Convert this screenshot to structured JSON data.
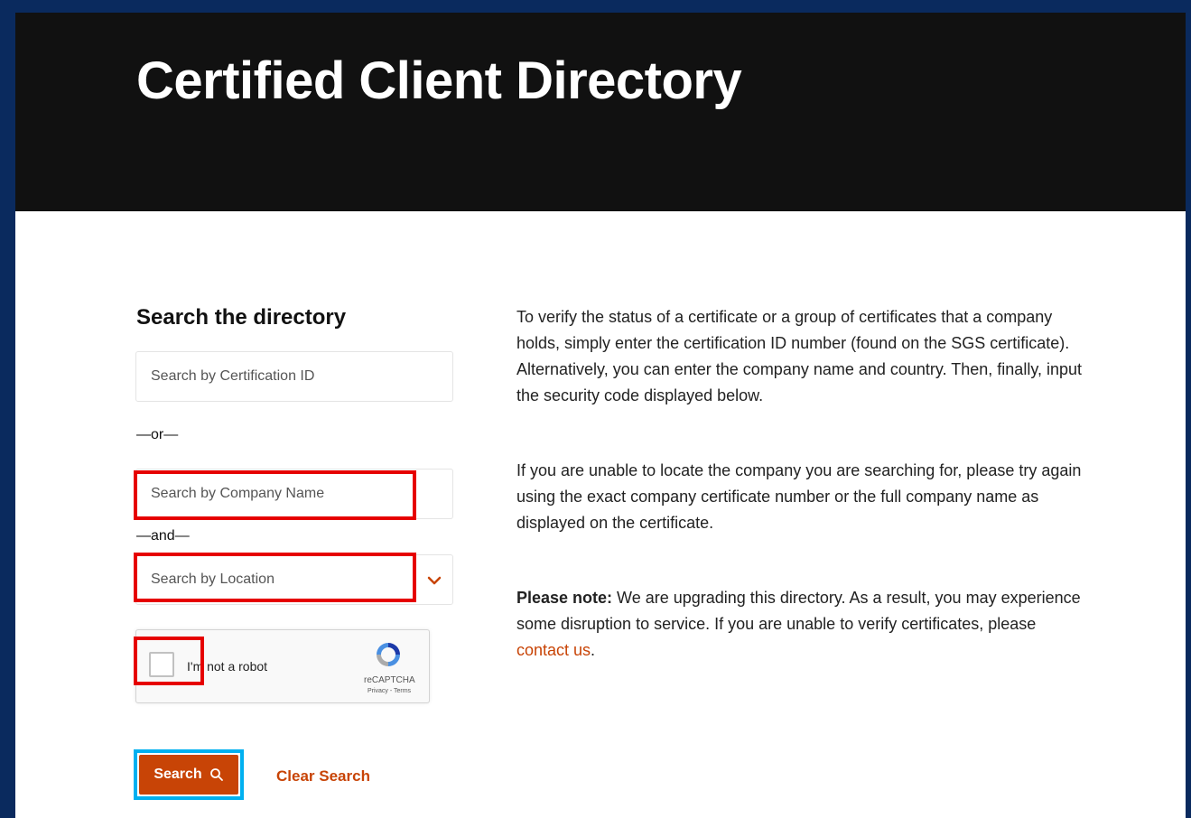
{
  "header": {
    "title": "Certified Client Directory"
  },
  "search": {
    "heading": "Search the directory",
    "cert_placeholder": "Search by Certification ID",
    "or_label": "—or—",
    "company_placeholder": "Search by Company Name",
    "and_label": "—and—",
    "location_placeholder": "Search by Location",
    "search_button": "Search",
    "clear_button": "Clear Search"
  },
  "captcha": {
    "label": "I'm not a robot",
    "brand": "reCAPTCHA",
    "links": "Privacy - Terms"
  },
  "info": {
    "para1": "To verify the status of a certificate or a group of certificates that a company holds, simply enter the certification ID number (found on the SGS certificate). Alternatively, you can enter the company name and country. Then, finally, input the security code displayed below.",
    "para2": "If you are unable to locate the company you are searching for, please try again using the exact company certificate number or the full company name as displayed on the certificate.",
    "note_bold": "Please note:",
    "note_text": " We are upgrading this directory. As a result, you may experience some disruption to service. If you are unable to verify certificates, please ",
    "contact_link": "contact us",
    "note_end": "."
  },
  "colors": {
    "accent": "#c84406",
    "highlight_red": "#e60000",
    "highlight_blue": "#00b0f0",
    "frame": "#0a2a5e"
  }
}
